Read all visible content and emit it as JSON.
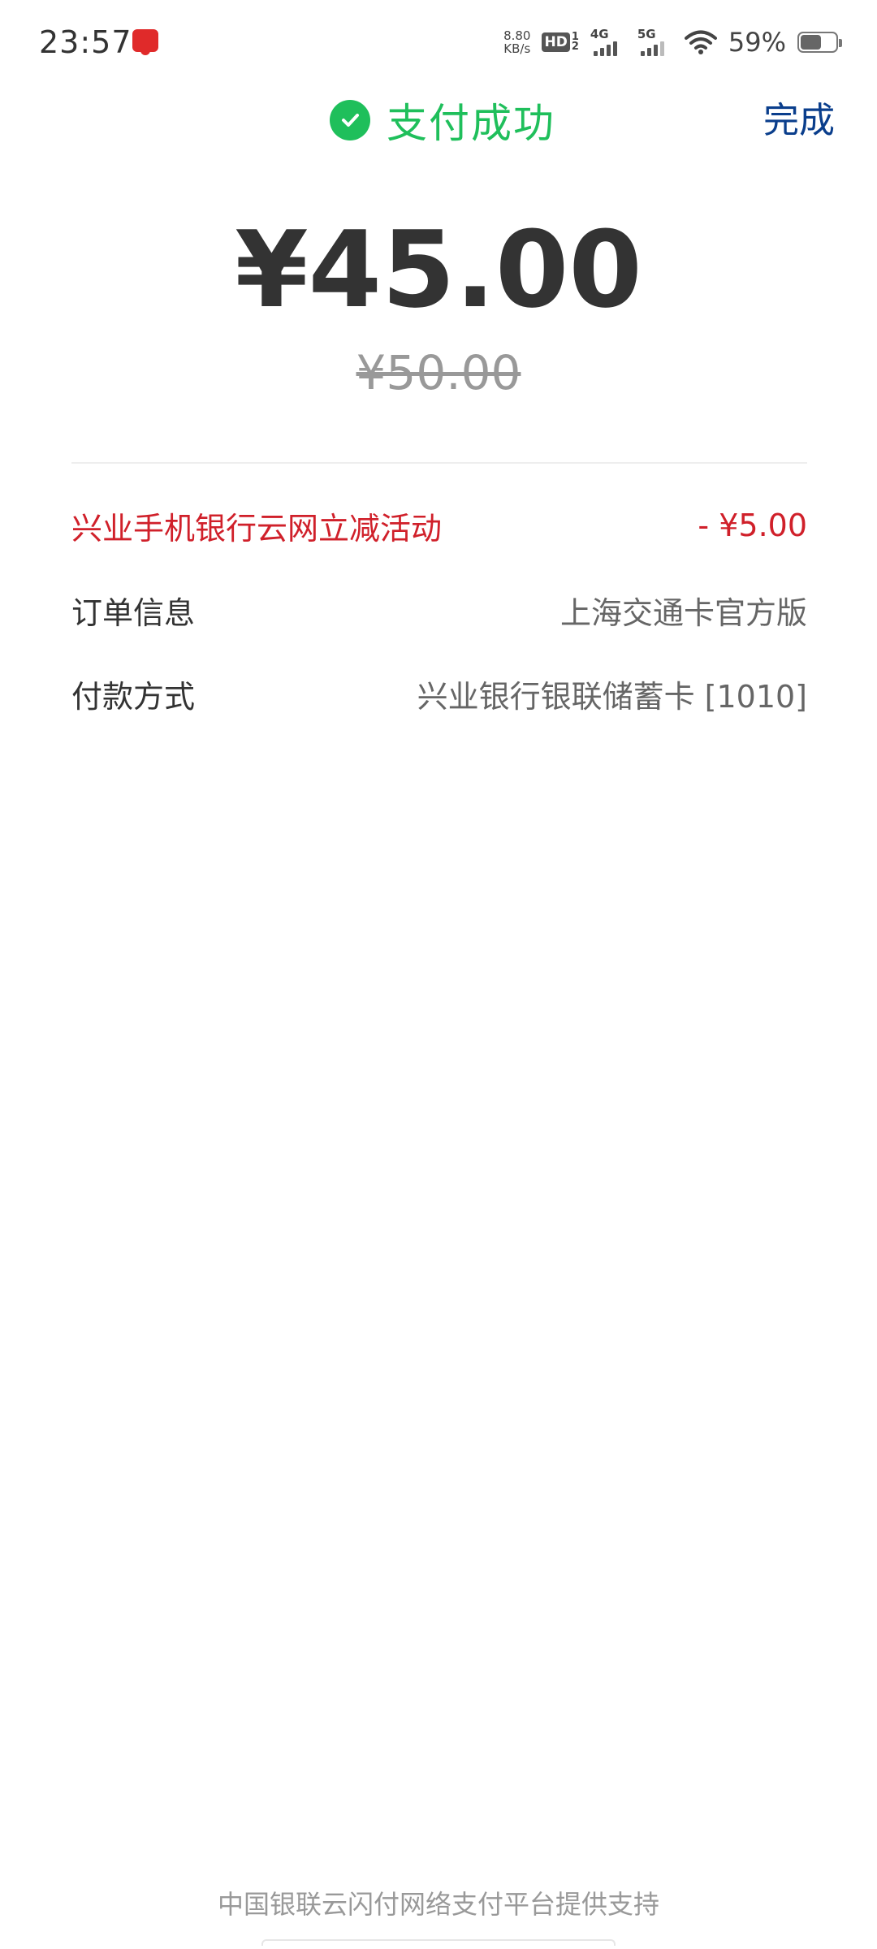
{
  "status_bar": {
    "time": "23:57",
    "net_speed_value": "8.80",
    "net_speed_unit": "KB/s",
    "hd_label": "HD",
    "hd_sub_top": "1",
    "hd_sub_bottom": "2",
    "signal_1_label": "4G",
    "signal_2_label": "5G",
    "battery_percent": "59%",
    "battery_level": 0.59,
    "icons": [
      "notification-app-icon",
      "hd-icon",
      "signal-4g-icon",
      "signal-5g-icon",
      "wifi-icon",
      "battery-icon"
    ]
  },
  "header": {
    "title": "支付成功",
    "done_label": "完成",
    "icon": "check-circle-icon"
  },
  "payment": {
    "amount": "¥45.00",
    "original_amount": "¥50.00"
  },
  "details": {
    "discount": {
      "label": "兴业手机银行云网立减活动",
      "value": "- ¥5.00"
    },
    "order": {
      "label": "订单信息",
      "value": "上海交通卡官方版"
    },
    "payment_method": {
      "label": "付款方式",
      "value": "兴业银行银联储蓄卡 [1010]"
    }
  },
  "footer": {
    "text": "中国银联云闪付网络支付平台提供支持"
  },
  "colors": {
    "success_green": "#1fbf5b",
    "done_blue": "#0a3e8c",
    "discount_red": "#d0202a",
    "amount_text": "#333333",
    "muted_text": "#999999"
  }
}
